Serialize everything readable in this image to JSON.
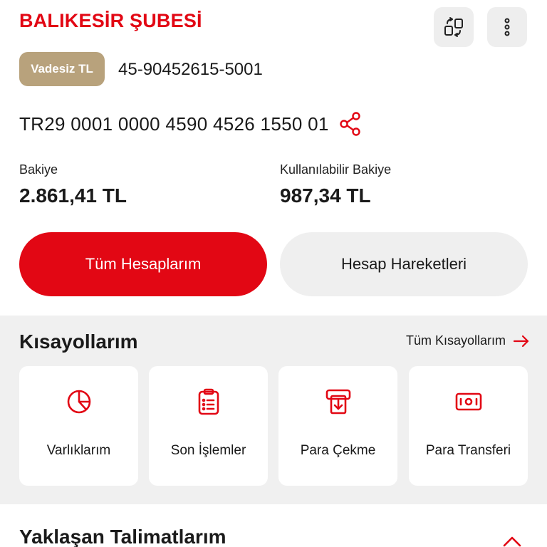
{
  "header": {
    "branch_title": "BALIKESİR ŞUBESİ",
    "swap_icon": "swap-accounts-icon",
    "more_icon": "more-vertical-icon"
  },
  "account": {
    "type_label": "Vadesiz TL",
    "number": "45-90452615-5001",
    "iban": "TR29 0001 0000 4590 4526 1550 01"
  },
  "balances": {
    "balance_label": "Bakiye",
    "balance_value": "2.861,41 TL",
    "available_label": "Kullanılabilir Bakiye",
    "available_value": "987,34 TL"
  },
  "actions": {
    "all_accounts": "Tüm Hesaplarım",
    "transactions": "Hesap Hareketleri"
  },
  "shortcuts": {
    "title": "Kısayollarım",
    "all_link": "Tüm Kısayollarım",
    "items": [
      {
        "label": "Varlıklarım",
        "icon": "pie-chart-icon"
      },
      {
        "label": "Son İşlemler",
        "icon": "clipboard-list-icon"
      },
      {
        "label": "Para Çekme",
        "icon": "atm-withdraw-icon"
      },
      {
        "label": "Para Transferi",
        "icon": "money-transfer-icon"
      }
    ]
  },
  "instructions": {
    "title": "Yaklaşan Talimatlarım"
  },
  "colors": {
    "brand_red": "#e20714",
    "tag_gold": "#b8a27c",
    "section_gray": "#f0f0f0"
  }
}
